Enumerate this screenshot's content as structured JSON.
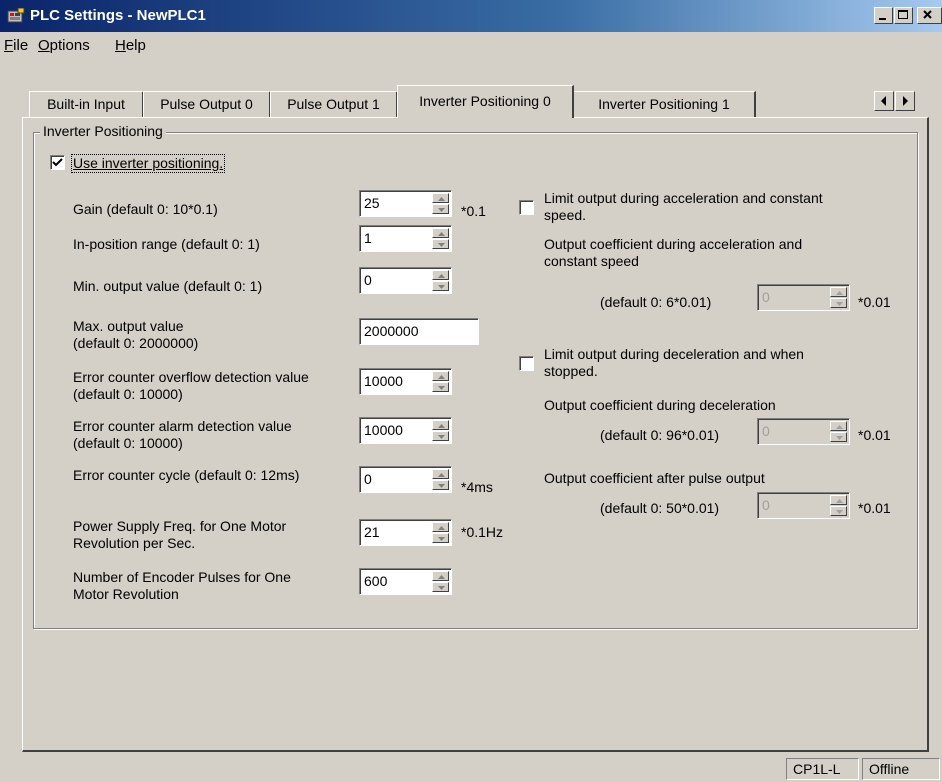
{
  "window": {
    "title": "PLC Settings - NewPLC1",
    "icon": "plc-app-icon",
    "caption_buttons": [
      "minimize-icon",
      "maximize-icon",
      "close-icon"
    ]
  },
  "menu": [
    {
      "label": "File",
      "accel": "F",
      "rest": "ile"
    },
    {
      "label": "Options",
      "accel": "O",
      "rest": "ptions"
    },
    {
      "label": "Help",
      "accel": "H",
      "rest": "elp"
    }
  ],
  "tabs": [
    {
      "label": "Built-in Input",
      "active": false
    },
    {
      "label": "Pulse Output 0",
      "active": false
    },
    {
      "label": "Pulse Output 1",
      "active": false
    },
    {
      "label": "Inverter Positioning 0",
      "active": true
    },
    {
      "label": "Inverter Positioning 1",
      "active": false
    }
  ],
  "group": {
    "title": "Inverter Positioning",
    "use_checkbox": {
      "label": "Use inverter positioning.",
      "checked": true
    }
  },
  "left_fields": {
    "gain": {
      "label": "Gain (default 0: 10*0.1)",
      "value": "25",
      "unit": "*0.1"
    },
    "in_position": {
      "label": "In-position range (default 0: 1)",
      "value": "1",
      "unit": ""
    },
    "min_output": {
      "label": "Min. output value (default 0: 1)",
      "value": "0",
      "unit": ""
    },
    "max_output": {
      "label_line1": "Max. output value",
      "label_line2": "(default 0: 2000000)",
      "value": "2000000"
    },
    "overflow": {
      "label_line1": "Error counter overflow detection value",
      "label_line2": "(default 0: 10000)",
      "value": "10000"
    },
    "alarm": {
      "label_line1": "Error counter alarm detection value",
      "label_line2": "(default 0: 10000)",
      "value": "10000"
    },
    "cycle": {
      "label": "Error counter cycle (default 0: 12ms)",
      "value": "0",
      "unit": "*4ms"
    },
    "freq": {
      "label_line1": "Power Supply Freq. for One Motor",
      "label_line2": "Revolution per Sec.",
      "value": "21",
      "unit": "*0.1Hz"
    },
    "encoder": {
      "label_line1": "Number of Encoder Pulses for One",
      "label_line2": "Motor Revolution",
      "value": "600"
    }
  },
  "right_section": {
    "limit_accel": {
      "checkbox_line1": "Limit output during acceleration and constant",
      "checkbox_line2": "speed.",
      "checked": false,
      "coef_title_line1": "Output coefficient during acceleration and",
      "coef_title_line2": "constant speed",
      "default_label": "(default 0: 6*0.01)",
      "value": "0",
      "unit": "*0.01"
    },
    "limit_decel": {
      "checkbox_line1": "Limit output during deceleration and when",
      "checkbox_line2": "stopped.",
      "checked": false,
      "coef_title": "Output coefficient during deceleration",
      "default_label": "(default 0: 96*0.01)",
      "value": "0",
      "unit": "*0.01"
    },
    "after_pulse": {
      "coef_title": "Output coefficient after pulse output",
      "default_label": "(default 0: 50*0.01)",
      "value": "0",
      "unit": "*0.01"
    }
  },
  "status_bar": {
    "model": "CP1L-L",
    "state": "Offline"
  }
}
